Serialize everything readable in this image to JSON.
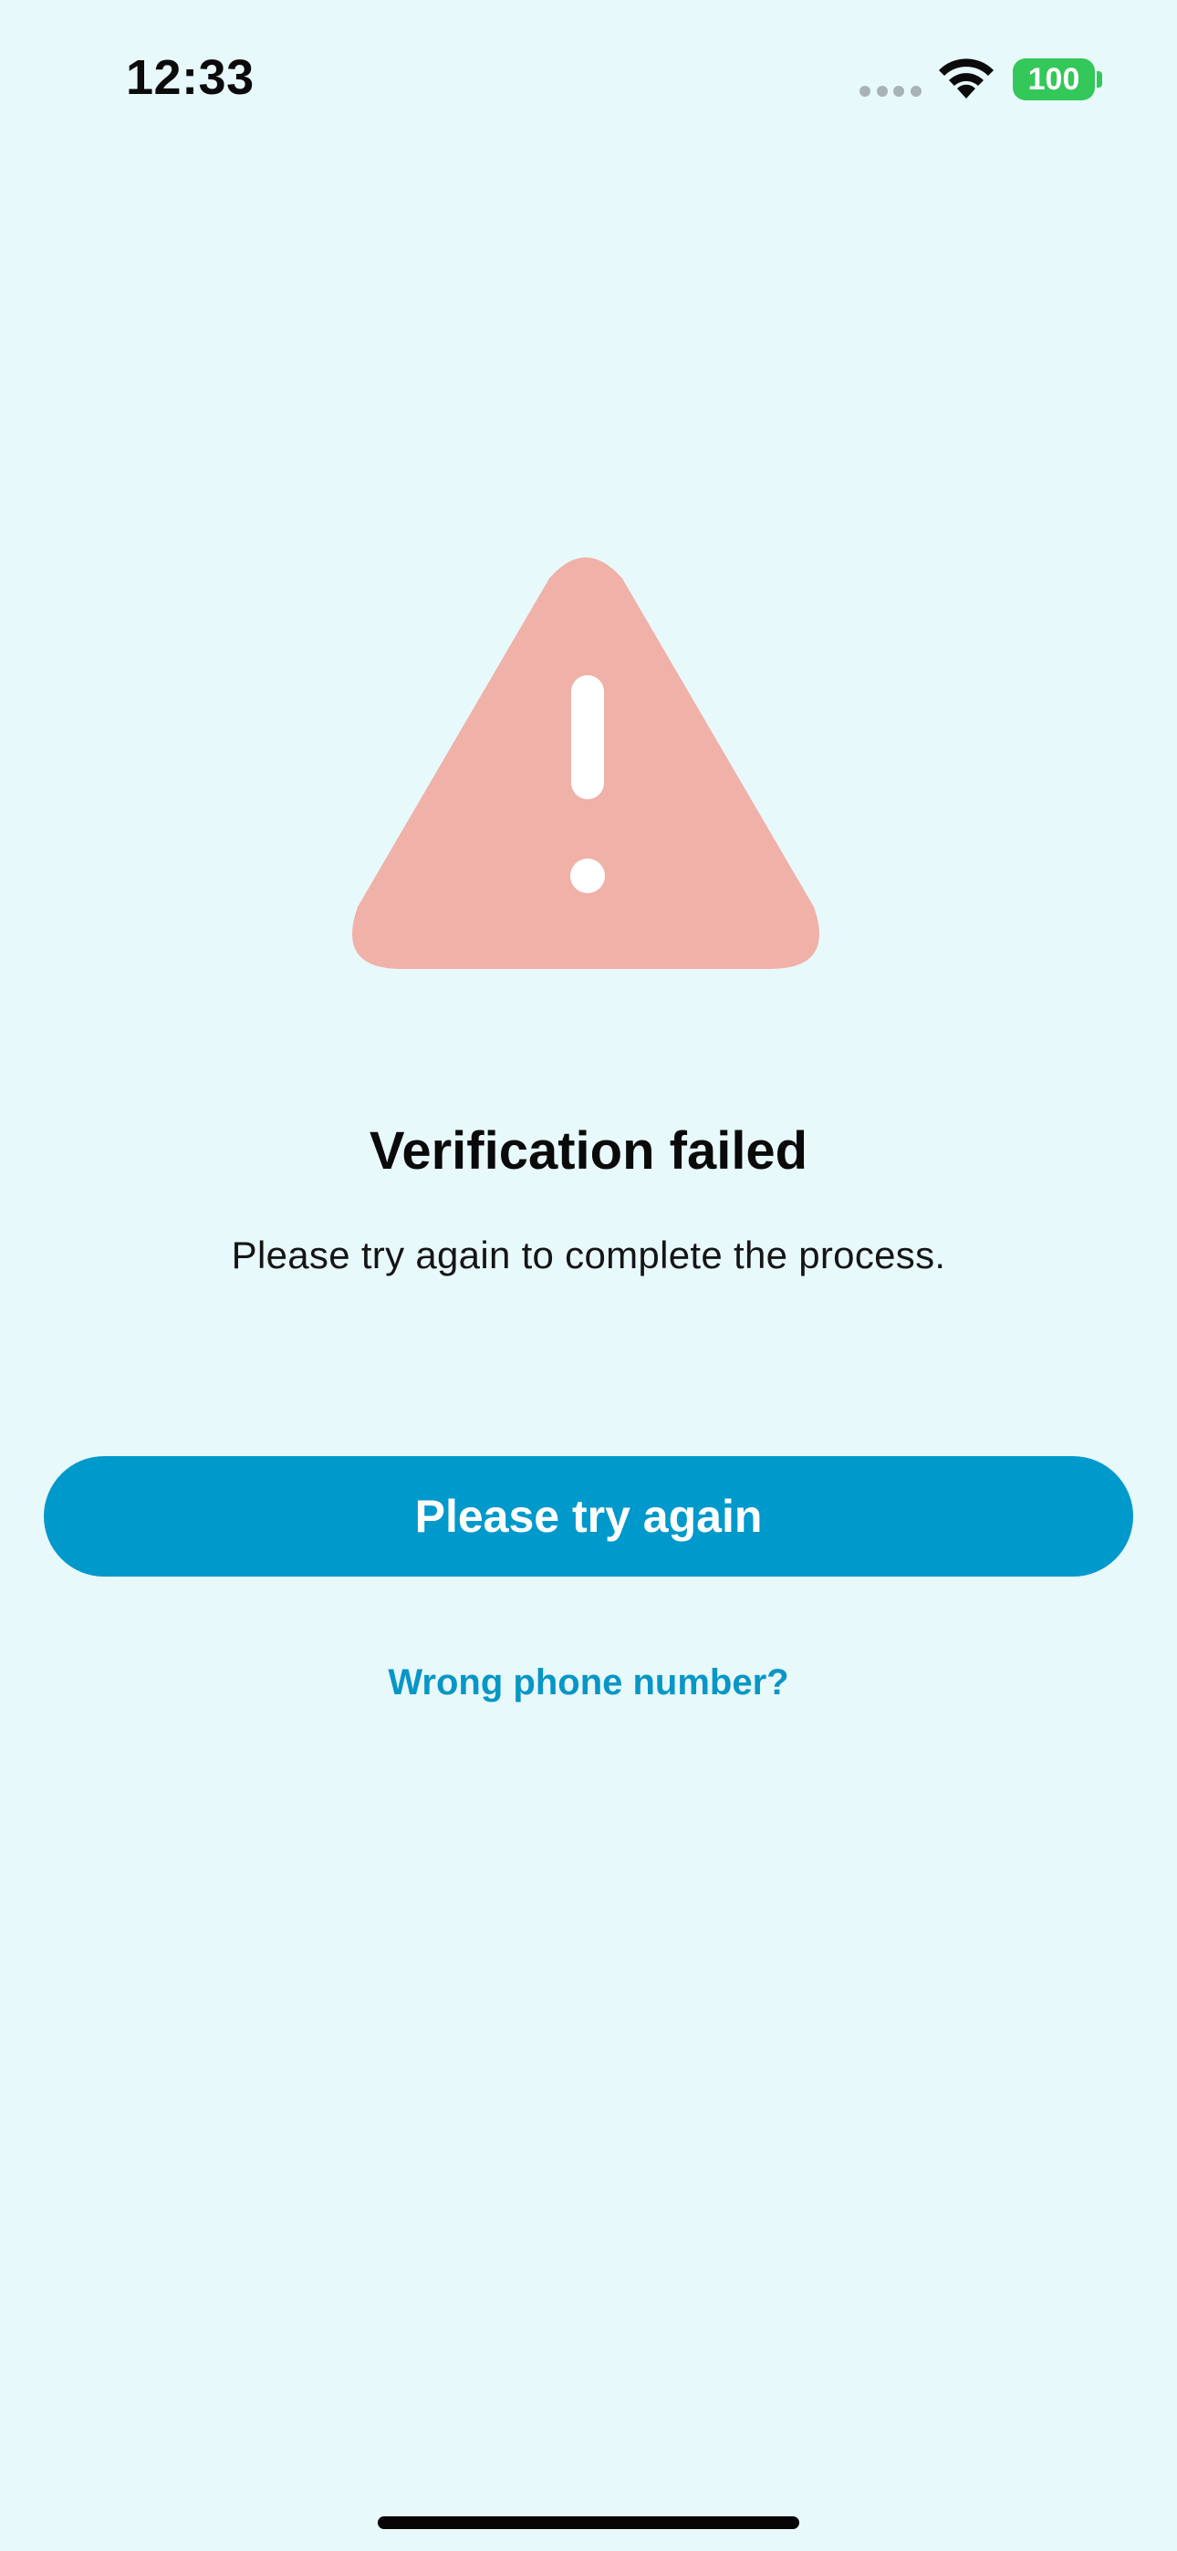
{
  "status_bar": {
    "time": "12:33",
    "battery": "100"
  },
  "colors": {
    "background": "#e8f9fc",
    "warning": "#efb1a8",
    "primary": "#0099cc",
    "link": "#0796c5",
    "battery": "#34c759"
  },
  "content": {
    "title": "Verification failed",
    "subtitle": "Please try again to complete the process.",
    "primary_button_label": "Please try again",
    "link_label": "Wrong phone number?"
  },
  "icons": {
    "illustration": "warning-triangle-icon",
    "wifi": "wifi-icon"
  }
}
